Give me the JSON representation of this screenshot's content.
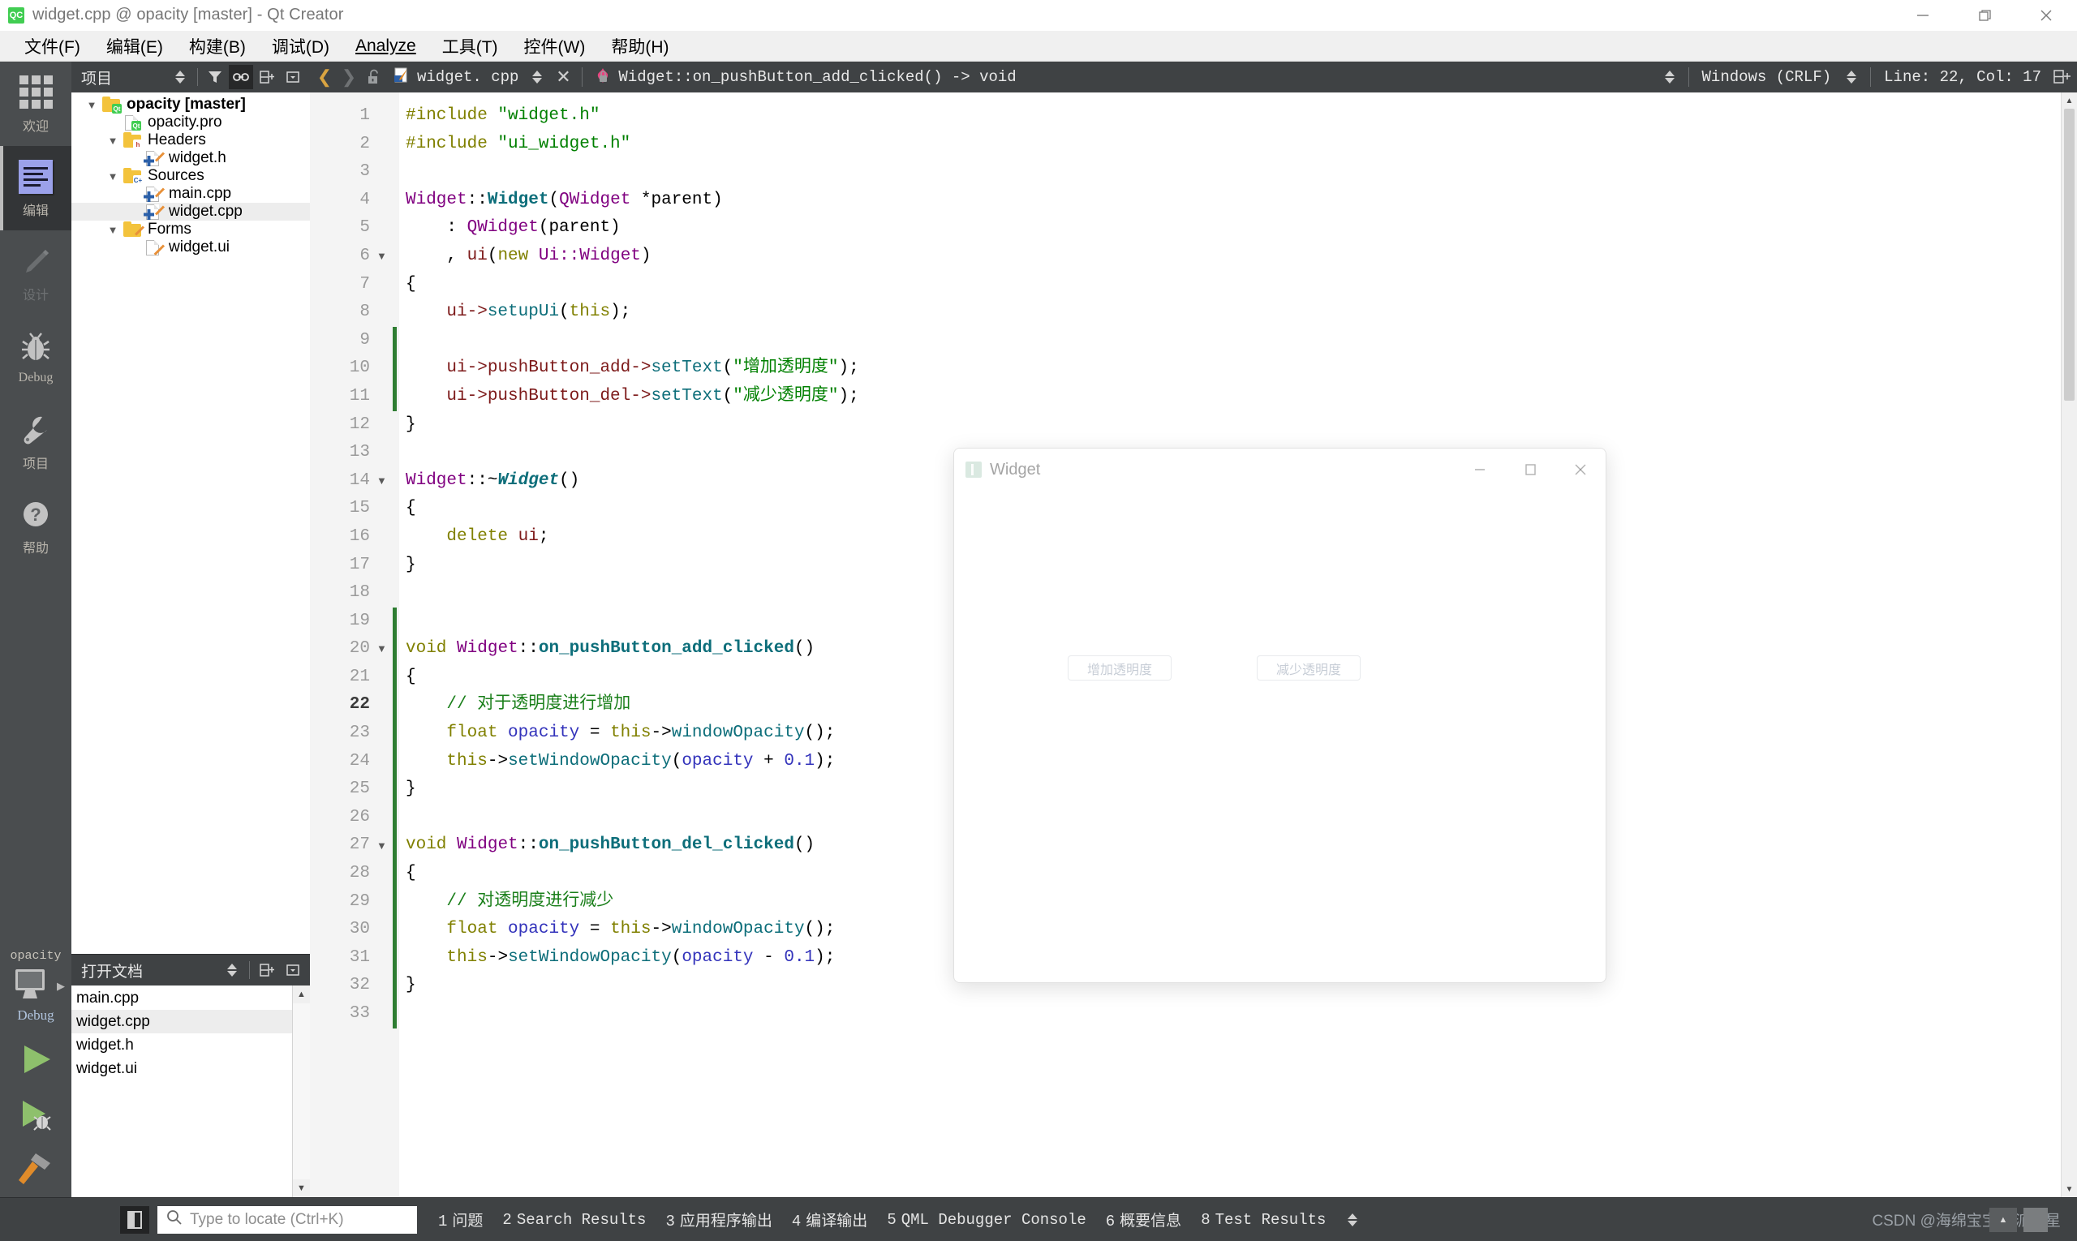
{
  "window": {
    "title": "widget.cpp @ opacity [master] - Qt Creator",
    "logo_text": "QC",
    "minimize": "—",
    "maximize": "▢",
    "close": "✕"
  },
  "menubar": {
    "items": [
      {
        "label": "文件(F)"
      },
      {
        "label": "编辑(E)"
      },
      {
        "label": "构建(B)"
      },
      {
        "label": "调试(D)"
      },
      {
        "label": "Analyze"
      },
      {
        "label": "工具(T)"
      },
      {
        "label": "控件(W)"
      },
      {
        "label": "帮助(H)"
      }
    ]
  },
  "modebar": {
    "modes": [
      {
        "label": "欢迎",
        "icon": "grid-icon",
        "active": false
      },
      {
        "label": "编辑",
        "icon": "document-lines-icon",
        "active": true
      },
      {
        "label": "设计",
        "icon": "pencil-icon",
        "active": false
      },
      {
        "label": "Debug",
        "icon": "bug-icon",
        "active": false
      },
      {
        "label": "项目",
        "icon": "wrench-icon",
        "active": false
      },
      {
        "label": "帮助",
        "icon": "question-mark-icon",
        "active": false
      }
    ],
    "kit": {
      "project_name": "opacity",
      "build_config": "Debug",
      "monitor_icon": "desktop-monitor-icon",
      "run_icon": "run-play-icon",
      "debug_icon": "run-debug-icon",
      "build_icon": "hammer-build-icon"
    }
  },
  "project_dock": {
    "title": "项目",
    "tools": [
      {
        "name": "filter-icon",
        "glyph": "▼"
      },
      {
        "name": "link-sync-icon",
        "glyph": "⛓"
      },
      {
        "name": "split-add-icon",
        "glyph": "⊟+"
      },
      {
        "name": "close-split-icon",
        "glyph": "⊡"
      }
    ],
    "tree": [
      {
        "indent": 0,
        "arrow": "▼",
        "icon": "folder-qt-icon",
        "label": "opacity [master]",
        "bold": true,
        "selected": false
      },
      {
        "indent": 1,
        "arrow": "",
        "icon": "file-pro-icon",
        "label": "opacity.pro",
        "bold": false,
        "selected": false
      },
      {
        "indent": 1,
        "arrow": "▼",
        "icon": "folder-h-icon",
        "label": "Headers",
        "bold": false,
        "selected": false
      },
      {
        "indent": 2,
        "arrow": "",
        "icon": "file-cpp-icon",
        "label": "widget.h",
        "bold": false,
        "selected": false
      },
      {
        "indent": 1,
        "arrow": "▼",
        "icon": "folder-cpp-icon",
        "label": "Sources",
        "bold": false,
        "selected": false
      },
      {
        "indent": 2,
        "arrow": "",
        "icon": "file-cpp-icon",
        "label": "main.cpp",
        "bold": false,
        "selected": false
      },
      {
        "indent": 2,
        "arrow": "",
        "icon": "file-cpp-icon",
        "label": "widget.cpp",
        "bold": false,
        "selected": true
      },
      {
        "indent": 1,
        "arrow": "▼",
        "icon": "folder-forms-icon",
        "label": "Forms",
        "bold": false,
        "selected": false
      },
      {
        "indent": 2,
        "arrow": "",
        "icon": "file-ui-icon",
        "label": "widget.ui",
        "bold": false,
        "selected": false
      }
    ]
  },
  "open_documents": {
    "title": "打开文档",
    "tools": [
      {
        "name": "sort-stepper-icon",
        "glyph": "⇅"
      },
      {
        "name": "split-add-icon",
        "glyph": "⊟+"
      },
      {
        "name": "close-split-icon",
        "glyph": "⊡"
      }
    ],
    "items": [
      {
        "label": "main.cpp",
        "selected": false
      },
      {
        "label": "widget.cpp",
        "selected": true
      },
      {
        "label": "widget.h",
        "selected": false
      },
      {
        "label": "widget.ui",
        "selected": false
      }
    ]
  },
  "editor_toolbar": {
    "back_arrow": "❮",
    "forward_arrow": "❯",
    "lock_icon": "unlock-icon",
    "file_name": "widget. cpp",
    "close_button": "✕",
    "symbol": "Widget::on_pushButton_add_clicked() -> void",
    "line_ending": "Windows (CRLF)",
    "cursor_position": "Line: 22, Col: 17",
    "split_icon": "⊟+"
  },
  "code": {
    "total_lines": 33,
    "current_line": 22,
    "fold_lines": [
      6,
      14,
      20,
      27
    ],
    "change_ranges": [
      [
        9,
        11
      ],
      [
        19,
        33
      ]
    ],
    "lines": [
      {
        "n": 1,
        "tokens": [
          {
            "t": "#include ",
            "c": "k-pre"
          },
          {
            "t": "\"widget.h\"",
            "c": "k-str"
          }
        ]
      },
      {
        "n": 2,
        "tokens": [
          {
            "t": "#include ",
            "c": "k-pre"
          },
          {
            "t": "\"ui_widget.h\"",
            "c": "k-str"
          }
        ]
      },
      {
        "n": 3,
        "tokens": []
      },
      {
        "n": 4,
        "tokens": [
          {
            "t": "Widget",
            "c": "k-type"
          },
          {
            "t": "::",
            "c": "k-op"
          },
          {
            "t": "Widget",
            "c": "k-func"
          },
          {
            "t": "(",
            "c": "k-op"
          },
          {
            "t": "QWidget",
            "c": "k-type"
          },
          {
            "t": " *parent)",
            "c": "k-op"
          }
        ]
      },
      {
        "n": 5,
        "tokens": [
          {
            "t": "    : ",
            "c": "k-op"
          },
          {
            "t": "QWidget",
            "c": "k-type"
          },
          {
            "t": "(parent)",
            "c": "k-op"
          }
        ]
      },
      {
        "n": 6,
        "tokens": [
          {
            "t": "    , ",
            "c": "k-op"
          },
          {
            "t": "ui",
            "c": "k-var"
          },
          {
            "t": "(",
            "c": "k-op"
          },
          {
            "t": "new",
            "c": "k-kw"
          },
          {
            "t": " ",
            "c": "k-op"
          },
          {
            "t": "Ui::Widget",
            "c": "k-type"
          },
          {
            "t": ")",
            "c": "k-op"
          }
        ]
      },
      {
        "n": 7,
        "tokens": [
          {
            "t": "{",
            "c": "k-op"
          }
        ]
      },
      {
        "n": 8,
        "tokens": [
          {
            "t": "    ui->",
            "c": "k-var"
          },
          {
            "t": "setupUi",
            "c": "k-fn2"
          },
          {
            "t": "(",
            "c": "k-op"
          },
          {
            "t": "this",
            "c": "k-kw"
          },
          {
            "t": ");",
            "c": "k-op"
          }
        ]
      },
      {
        "n": 9,
        "tokens": []
      },
      {
        "n": 10,
        "tokens": [
          {
            "t": "    ui->pushButton_add->",
            "c": "k-var"
          },
          {
            "t": "setText",
            "c": "k-fn2"
          },
          {
            "t": "(",
            "c": "k-op"
          },
          {
            "t": "\"增加透明度\"",
            "c": "k-str"
          },
          {
            "t": ");",
            "c": "k-op"
          }
        ]
      },
      {
        "n": 11,
        "tokens": [
          {
            "t": "    ui->pushButton_del->",
            "c": "k-var"
          },
          {
            "t": "setText",
            "c": "k-fn2"
          },
          {
            "t": "(",
            "c": "k-op"
          },
          {
            "t": "\"减少透明度\"",
            "c": "k-str"
          },
          {
            "t": ");",
            "c": "k-op"
          }
        ]
      },
      {
        "n": 12,
        "tokens": [
          {
            "t": "}",
            "c": "k-op"
          }
        ]
      },
      {
        "n": 13,
        "tokens": []
      },
      {
        "n": 14,
        "tokens": [
          {
            "t": "Widget",
            "c": "k-type"
          },
          {
            "t": "::~",
            "c": "k-op"
          },
          {
            "t": "Widget",
            "c": "k-func k-italic"
          },
          {
            "t": "()",
            "c": "k-op"
          }
        ]
      },
      {
        "n": 15,
        "tokens": [
          {
            "t": "{",
            "c": "k-op"
          }
        ]
      },
      {
        "n": 16,
        "tokens": [
          {
            "t": "    ",
            "c": "k-op"
          },
          {
            "t": "delete",
            "c": "k-kw"
          },
          {
            "t": " ",
            "c": "k-op"
          },
          {
            "t": "ui",
            "c": "k-var"
          },
          {
            "t": ";",
            "c": "k-op"
          }
        ]
      },
      {
        "n": 17,
        "tokens": [
          {
            "t": "}",
            "c": "k-op"
          }
        ]
      },
      {
        "n": 18,
        "tokens": []
      },
      {
        "n": 19,
        "tokens": []
      },
      {
        "n": 20,
        "tokens": [
          {
            "t": "void",
            "c": "k-kw"
          },
          {
            "t": " ",
            "c": "k-op"
          },
          {
            "t": "Widget",
            "c": "k-type"
          },
          {
            "t": "::",
            "c": "k-op"
          },
          {
            "t": "on_pushButton_add_clicked",
            "c": "k-func"
          },
          {
            "t": "()",
            "c": "k-op"
          }
        ]
      },
      {
        "n": 21,
        "tokens": [
          {
            "t": "{",
            "c": "k-op"
          }
        ]
      },
      {
        "n": 22,
        "tokens": [
          {
            "t": "    // 对于透明度进行增加",
            "c": "k-cmt"
          }
        ]
      },
      {
        "n": 23,
        "tokens": [
          {
            "t": "    ",
            "c": "k-op"
          },
          {
            "t": "float",
            "c": "k-kw"
          },
          {
            "t": " ",
            "c": "k-op"
          },
          {
            "t": "opacity",
            "c": "k-num"
          },
          {
            "t": " = ",
            "c": "k-op"
          },
          {
            "t": "this",
            "c": "k-kw"
          },
          {
            "t": "->",
            "c": "k-op"
          },
          {
            "t": "windowOpacity",
            "c": "k-fn2"
          },
          {
            "t": "();",
            "c": "k-op"
          }
        ]
      },
      {
        "n": 24,
        "tokens": [
          {
            "t": "    ",
            "c": "k-op"
          },
          {
            "t": "this",
            "c": "k-kw"
          },
          {
            "t": "->",
            "c": "k-op"
          },
          {
            "t": "setWindowOpacity",
            "c": "k-fn2"
          },
          {
            "t": "(",
            "c": "k-op"
          },
          {
            "t": "opacity",
            "c": "k-num"
          },
          {
            "t": " + ",
            "c": "k-op"
          },
          {
            "t": "0.1",
            "c": "k-num"
          },
          {
            "t": ");",
            "c": "k-op"
          }
        ]
      },
      {
        "n": 25,
        "tokens": [
          {
            "t": "}",
            "c": "k-op"
          }
        ]
      },
      {
        "n": 26,
        "tokens": []
      },
      {
        "n": 27,
        "tokens": [
          {
            "t": "void",
            "c": "k-kw"
          },
          {
            "t": " ",
            "c": "k-op"
          },
          {
            "t": "Widget",
            "c": "k-type"
          },
          {
            "t": "::",
            "c": "k-op"
          },
          {
            "t": "on_pushButton_del_clicked",
            "c": "k-func"
          },
          {
            "t": "()",
            "c": "k-op"
          }
        ]
      },
      {
        "n": 28,
        "tokens": [
          {
            "t": "{",
            "c": "k-op"
          }
        ]
      },
      {
        "n": 29,
        "tokens": [
          {
            "t": "    // 对透明度进行减少",
            "c": "k-cmt"
          }
        ]
      },
      {
        "n": 30,
        "tokens": [
          {
            "t": "    ",
            "c": "k-op"
          },
          {
            "t": "float",
            "c": "k-kw"
          },
          {
            "t": " ",
            "c": "k-op"
          },
          {
            "t": "opacity",
            "c": "k-num"
          },
          {
            "t": " = ",
            "c": "k-op"
          },
          {
            "t": "this",
            "c": "k-kw"
          },
          {
            "t": "->",
            "c": "k-op"
          },
          {
            "t": "windowOpacity",
            "c": "k-fn2"
          },
          {
            "t": "();",
            "c": "k-op"
          }
        ]
      },
      {
        "n": 31,
        "tokens": [
          {
            "t": "    ",
            "c": "k-op"
          },
          {
            "t": "this",
            "c": "k-kw"
          },
          {
            "t": "->",
            "c": "k-op"
          },
          {
            "t": "setWindowOpacity",
            "c": "k-fn2"
          },
          {
            "t": "(",
            "c": "k-op"
          },
          {
            "t": "opacity",
            "c": "k-num"
          },
          {
            "t": " - ",
            "c": "k-op"
          },
          {
            "t": "0.1",
            "c": "k-num"
          },
          {
            "t": ");",
            "c": "k-op"
          }
        ]
      },
      {
        "n": 32,
        "tokens": [
          {
            "t": "}",
            "c": "k-op"
          }
        ]
      },
      {
        "n": 33,
        "tokens": []
      }
    ]
  },
  "float_window": {
    "title": "Widget",
    "minimize": "—",
    "maximize": "▢",
    "close": "✕",
    "buttons": [
      {
        "label": "增加透明度"
      },
      {
        "label": "减少透明度"
      }
    ]
  },
  "statusbar": {
    "locator_placeholder": "Type to locate (Ctrl+K)",
    "search_icon": "search-magnifier-icon",
    "panes": [
      {
        "num": "1",
        "label": "问题"
      },
      {
        "num": "2",
        "label": "Search Results"
      },
      {
        "num": "3",
        "label": "应用程序输出"
      },
      {
        "num": "4",
        "label": "编译输出"
      },
      {
        "num": "5",
        "label": "QML Debugger Console"
      },
      {
        "num": "6",
        "label": "概要信息"
      },
      {
        "num": "8",
        "label": "Test Results"
      }
    ],
    "watermark": "CSDN @海绵宝宝de派小星"
  },
  "colors": {
    "accent_green": "#41cd52",
    "dark_chrome": "#3f4244",
    "modebar": "#4a4d4f",
    "active_mode": "#333537",
    "selection": "#ededed",
    "change_bar": "#2e7d32"
  }
}
